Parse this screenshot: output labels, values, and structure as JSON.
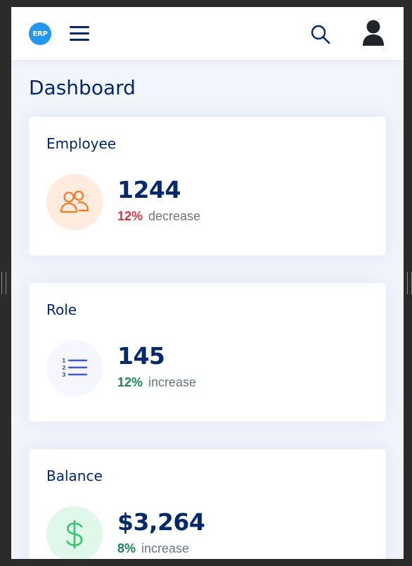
{
  "header": {
    "logo_text": "ERP",
    "menu_icon": "hamburger-menu-icon",
    "search_icon": "search-icon",
    "profile_icon": "user-avatar-icon"
  },
  "page": {
    "title": "Dashboard"
  },
  "cards": [
    {
      "title": "Employee",
      "value": "1244",
      "percent": "12%",
      "trend": "decrease",
      "icon": "people-icon",
      "icon_color": "#ff771d",
      "icon_bg": "#ffecdf",
      "percent_color": "#dc3545"
    },
    {
      "title": "Role",
      "value": "145",
      "percent": "12%",
      "trend": "increase",
      "icon": "numbered-list-icon",
      "icon_color": "#4154f1",
      "icon_bg": "#f6f6fe",
      "percent_color": "#198754"
    },
    {
      "title": "Balance",
      "value": "$3,264",
      "percent": "8%",
      "trend": "increase",
      "icon": "dollar-icon",
      "icon_color": "#2eca6a",
      "icon_bg": "#e0f8e9",
      "percent_color": "#198754"
    }
  ]
}
